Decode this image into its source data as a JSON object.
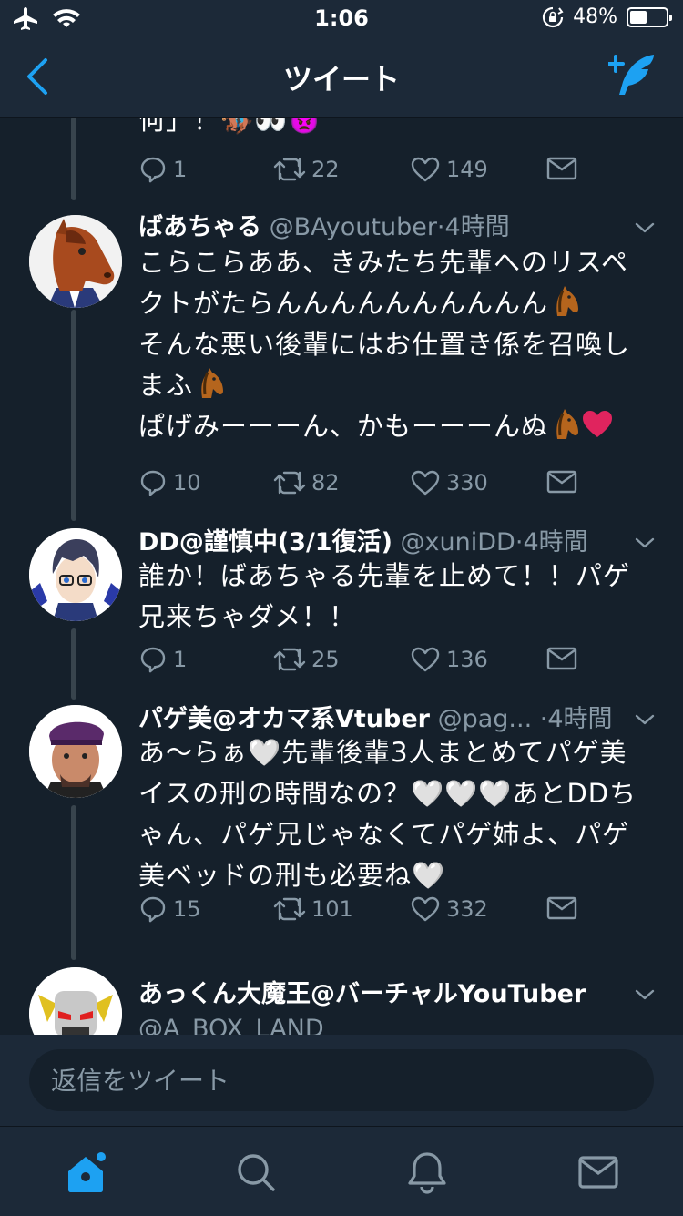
{
  "status_bar": {
    "time": "1:06",
    "battery": "48%",
    "battery_level": 0.48
  },
  "nav": {
    "title": "ツイート"
  },
  "partial_tweet": {
    "text": "何」！🏇👀👿",
    "replies": "1",
    "retweets": "22",
    "likes": "149"
  },
  "tweets": [
    {
      "name": "ばあちゃる",
      "handle": "@BAyoutuber",
      "time": "4時間",
      "line1": "こらこらああ、きみたち先輩へのリスペクトがたらんんんんんんんんんん",
      "line2": "そんな悪い後輩にはお仕置き係を召喚しまふ",
      "line3": "ぱげみーーーん、かもーーーんぬ",
      "replies": "10",
      "retweets": "82",
      "likes": "330"
    },
    {
      "name": "DD@謹慎中(3/1復活)",
      "handle": "@xuniDD",
      "time": "4時間",
      "text": "誰か！ばあちゃる先輩を止めて！！パゲ兄来ちゃダメ！！",
      "replies": "1",
      "retweets": "25",
      "likes": "136"
    },
    {
      "name": "パゲ美@オカマ系Vtuber",
      "handle": "@pag...",
      "time": "4時間",
      "text": "あ〜らぁ🤍先輩後輩3人まとめてパゲ美イスの刑の時間なの？🤍🤍🤍あとDDちゃん、パゲ兄じゃなくてパゲ姉よ、パゲ美ベッドの刑も必要ね🤍",
      "replies": "15",
      "retweets": "101",
      "likes": "332"
    },
    {
      "name": "あっくん大魔王@バーチャルYouTuber",
      "handle": "@A_BOX_LAND"
    }
  ],
  "composer": {
    "placeholder": "返信をツイート"
  },
  "colors": {
    "background": "#15202b",
    "bar": "#1c2938",
    "accent": "#1da1f2",
    "muted": "#8899a6"
  },
  "icons": [
    "airplane-icon",
    "wifi-icon",
    "rotation-lock-icon",
    "battery-icon",
    "back-chevron-icon",
    "compose-icon",
    "reply-icon",
    "retweet-icon",
    "like-icon",
    "dm-icon",
    "caret-down-icon",
    "home-icon",
    "search-icon",
    "notifications-icon",
    "messages-icon",
    "horse-emoji",
    "heart-emoji"
  ]
}
